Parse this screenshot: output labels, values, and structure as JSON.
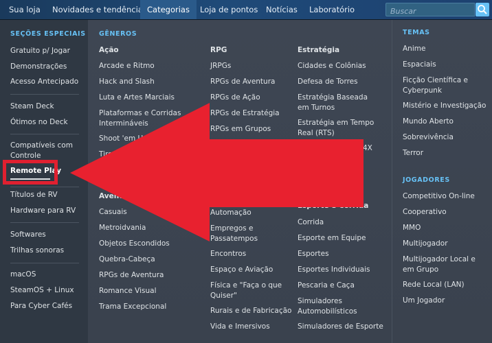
{
  "topnav": {
    "items": [
      {
        "label": "Sua loja"
      },
      {
        "label": "Novidades e tendências"
      },
      {
        "label": "Categorias"
      },
      {
        "label": "Loja de pontos"
      },
      {
        "label": "Notícias"
      },
      {
        "label": "Laboratório"
      }
    ],
    "active": "Categorias",
    "search_placeholder": "Buscar"
  },
  "menu": {
    "special_sections": {
      "heading": "SEÇÕES ESPECIAIS",
      "groups": [
        [
          "Gratuito p/ Jogar",
          "Demonstrações",
          "Acesso Antecipado"
        ],
        [
          "Steam Deck",
          "Ótimos no Deck"
        ],
        [
          "Compatíveis com Controle",
          "Remote Play"
        ],
        [
          "Títulos de RV",
          "Hardware para RV"
        ],
        [
          "Softwares",
          "Trilhas sonoras"
        ],
        [
          "macOS",
          "SteamOS + Linux",
          "Para Cyber Cafés"
        ]
      ]
    },
    "genres": {
      "heading": "GÊNEROS",
      "col1": [
        "Ação",
        "Arcade e Ritmo",
        "Hack and Slash",
        "Luta e Artes Marciais",
        "Plataformas e Corridas Intermináveis",
        "Shoot 'em Up",
        "Tiro",
        "Aventura",
        "Casuais",
        "Metroidvania",
        "Objetos Escondidos",
        "Quebra-Cabeça",
        "RPGs de Aventura",
        "Romance Visual",
        "Trama Excepcional"
      ],
      "col2": [
        "RPG",
        "JRPGs",
        "RPGs de Aventura",
        "RPGs de Ação",
        "RPGs de Estratégia",
        "RPGs em Grupos",
        "Automação",
        "Empregos e Passatempos",
        "Encontros",
        "Espaço e Aviação",
        "Física e \"Faça o que Quiser\"",
        "Rurais e de Fabricação",
        "Vida e Imersivos"
      ],
      "col3": [
        "Estratégia",
        "Cidades e Colônias",
        "Defesa de Torres",
        "Estratégia Baseada em Turnos",
        "Estratégia em Tempo Real (RTS)",
        "4X",
        "Esporte e Corrida",
        "Corrida",
        "Esporte em Equipe",
        "Esportes",
        "Esportes Individuais",
        "Pescaria e Caça",
        "Simuladores Automobilísticos",
        "Simuladores de Esporte"
      ]
    },
    "themes": {
      "heading": "TEMAS",
      "items": [
        "Anime",
        "Espaciais",
        "Ficção Científica e Cyberpunk",
        "Mistério e Investigação",
        "Mundo Aberto",
        "Sobrevivência",
        "Terror"
      ]
    },
    "players": {
      "heading": "JOGADORES",
      "items": [
        "Competitivo On-line",
        "Cooperativo",
        "MMO",
        "Multijogador",
        "Multijogador Local e em Grupo",
        "Rede Local (LAN)",
        "Um Jogador"
      ]
    }
  },
  "annotation": {
    "highlighted_item": "Remote Play",
    "color": "#e02030"
  }
}
